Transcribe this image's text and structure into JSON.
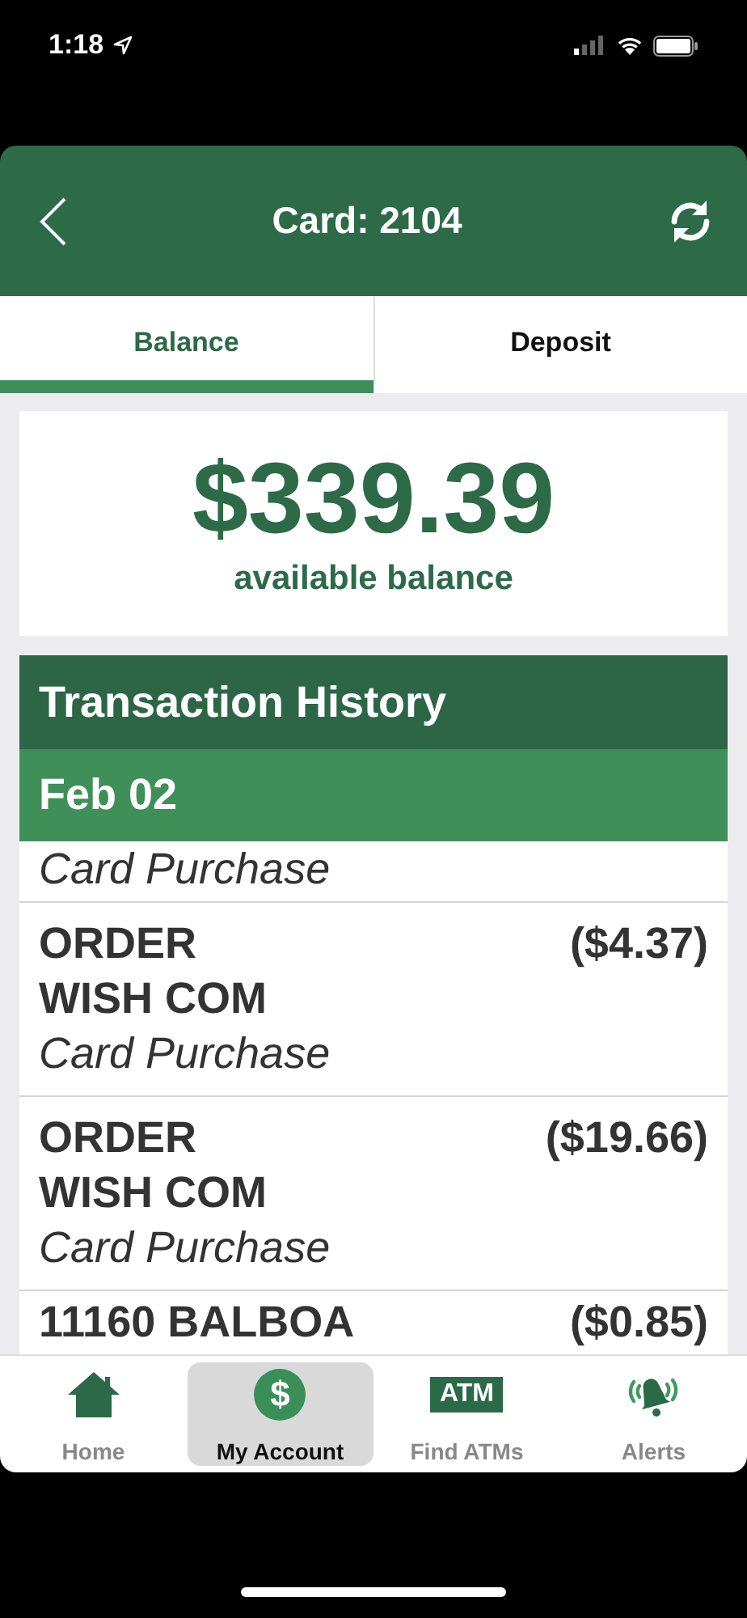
{
  "status_bar": {
    "time": "1:18"
  },
  "header": {
    "title": "Card: 2104"
  },
  "tabs": [
    {
      "label": "Balance",
      "selected": true
    },
    {
      "label": "Deposit",
      "selected": false
    }
  ],
  "balance": {
    "amount": "$339.39",
    "caption": "available balance"
  },
  "history": {
    "title": "Transaction History",
    "date": "Feb 02",
    "transactions": [
      {
        "kind": "partial_top",
        "description": "Card Purchase"
      },
      {
        "kind": "full",
        "name": "ORDER\nWISH COM",
        "amount": "($4.37)",
        "description": "Card Purchase"
      },
      {
        "kind": "full",
        "name": "ORDER\nWISH COM",
        "amount": "($19.66)",
        "description": "Card Purchase"
      },
      {
        "kind": "partial_bottom",
        "name": "11160 BALBOA",
        "amount": "($0.85)"
      }
    ]
  },
  "tab_bar": [
    {
      "kind": "home",
      "label": "Home",
      "selected": false
    },
    {
      "kind": "dollar",
      "label": "My Account",
      "icon_text": "$",
      "selected": true
    },
    {
      "kind": "atm",
      "label": "Find ATMs",
      "icon_text": "ATM",
      "selected": false
    },
    {
      "kind": "bell",
      "label": "Alerts",
      "selected": false
    }
  ]
}
